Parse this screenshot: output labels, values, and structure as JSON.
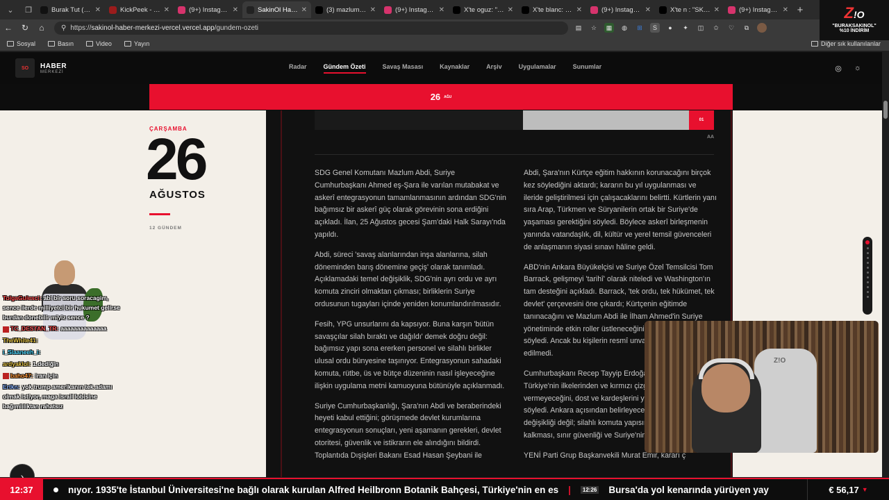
{
  "tabs": [
    {
      "title": "Burak Tut (@bur",
      "icon_color": "#111111"
    },
    {
      "title": "KickPeek - Real-t",
      "icon_color": "#9b1c1c"
    },
    {
      "title": "(9+) Instagram",
      "icon_color": "#d6336c"
    },
    {
      "title": "SakinOl Haber M",
      "icon_color": "#222222",
      "active": true
    },
    {
      "title": "(3) mazlum abdi",
      "icon_color": "#000000"
    },
    {
      "title": "(9+) Instagram",
      "icon_color": "#d6336c"
    },
    {
      "title": "X'te oguz: \"Soy i",
      "icon_color": "#000000"
    },
    {
      "title": "X'te blanc: \"DEFO",
      "icon_color": "#000000"
    },
    {
      "title": "(9+) Instagram",
      "icon_color": "#d6336c"
    },
    {
      "title": "X'te n : \"SKWK",
      "icon_color": "#000000"
    },
    {
      "title": "(9+) Instagram",
      "icon_color": "#d6336c"
    }
  ],
  "url": {
    "scheme": "https://",
    "host": "sakinol-haber-merkezi-vercel.vercel.app",
    "path": "/gundem-ozeti"
  },
  "bookmarks": [
    "Sosyal",
    "Basın",
    "Video",
    "Yayın"
  ],
  "bookmarks_right": "Diğer sık kullanılanlar",
  "stream_logo": {
    "line1": "\"BURAKSAKINOL\"",
    "line2": "%10 İNDİRİM"
  },
  "site": {
    "brand_line1": "HABER",
    "brand_line2": "MERKEZİ",
    "nav": [
      "Radar",
      "Gündem Özeti",
      "Savaş Masası",
      "Kaynaklar",
      "Arşiv",
      "Uygulamalar",
      "Sunumlar"
    ],
    "nav_active": "Gündem Özeti"
  },
  "band": {
    "day": "26",
    "month": "AĞU"
  },
  "date_panel": {
    "weekday": "ÇARŞAMBA",
    "day": "26",
    "month": "AĞUSTOS",
    "count": "12 GÜNDEM"
  },
  "article": {
    "image_badge": "01",
    "aa_label": "AA",
    "col1": [
      "SDG Genel Komutanı Mazlum Abdi, Suriye Cumhurbaşkanı Ahmed eş-Şara ile varılan mutabakat ve askerî entegrasyonun tamamlanmasının ardından SDG'nin bağımsız bir askerî güç olarak görevinin sona erdiğini açıkladı. İlan, 25 Ağustos gecesi Şam'daki Halk Sarayı'nda yapıldı.",
      "Abdi, süreci 'savaş alanlarından inşa alanlarına, silah döneminden barış dönemine geçiş' olarak tanımladı. Açıklamadaki temel değişiklik, SDG'nin ayrı ordu ve ayrı komuta zinciri olmaktan çıkması; birliklerin Suriye ordusunun tugayları içinde yeniden konumlandırılmasıdır.",
      "Fesih, YPG unsurlarını da kapsıyor. Buna karşın 'bütün savaşçılar silah bıraktı ve dağıldı' demek doğru değil: bağımsız yapı sona ererken personel ve silahlı birlikler ulusal ordu bünyesine taşınıyor. Entegrasyonun sahadaki komuta, rütbe, üs ve bütçe düzeninin nasıl işleyeceğine ilişkin uygulama metni kamuoyuna bütünüyle açıklanmadı.",
      "Suriye Cumhurbaşkanlığı, Şara'nın Abdi ve beraberindeki heyeti kabul ettiğini; görüşmede devlet kurumlarına entegrasyonun sonuçları, yeni aşamanın gerekleri, devlet otoritesi, güvenlik ve istikrarın ele alındığını bildirdi. Toplantıda Dışişleri Bakanı Esad Hasan Şeybani ile"
    ],
    "col2": [
      "Abdi, Şara'nın Kürtçe eğitim hakkının korunacağını birçok kez söylediğini aktardı; kararın bu yıl uygulanması ve ileride geliştirilmesi için çalışacaklarını belirtti. Kürtlerin yanı sıra Arap, Türkmen ve Süryanilerin ortak bir Suriye'de yaşaması gerektiğini söyledi. Böylece askerî birleşmenin yanında vatandaşlık, dil, kültür ve yerel temsil güvenceleri de anlaşmanın siyasi sınavı hâline geldi.",
      "ABD'nin Ankara Büyükelçisi ve Suriye Özel Temsilcisi Tom Barrack, gelişmeyi 'tarihî' olarak niteledi ve Washington'ın tam desteğini açıkladı. Barrack, 'tek ordu, tek hükümet, tek devlet' çerçevesini öne çıkardı; Kürtçenin eğitimde tanınacağını ve Mazlum Abdi ile İlham Ahmed'in Suriye yönetiminde etkin roller üstleneceğini öngörüldüğünü söyledi. Ancak bu kişilerin resmî unvanları resmen ilan edilmedi.",
      "Cumhurbaşkanı Recep Tayyip Erdoğan ardından Türkiye'nin ilkelerinden ve kırmızı çizgilerinden taviz vermeyeceğini, dost ve kardeşlerini yalnız bırakmayacağını söyledi. Ankara açısından belirleyecek ölçüt yalnızca isim değişikliği değil; silahlı komuta yapısının fiilen ortadan kalkması, sınır güvenliği ve Suriye'nin toprak bütünlüğü.",
      "YENİ Parti Grup Başkanvekili Murat Emir, kararı ç"
    ]
  },
  "chat": [
    {
      "user": "TolgaGulesci:",
      "text": "abi bir soru soracagim, sence ilerde milliyetci bir hukumet gelirse burdan donebilir miyiz sence ?",
      "color_class": "u1"
    },
    {
      "user": "TC_DESTAN_TR:",
      "text": "aaaaaaaaaaaaaa",
      "color_class": "u2",
      "badge": true
    },
    {
      "user": "TheWhite41:",
      "text": "",
      "color_class": "u5"
    },
    {
      "user": "i_Slaaneeh_i:",
      "text": "",
      "color_class": "u4"
    },
    {
      "user": "ardyaklol:",
      "text": "1.dediğin",
      "color_class": "u5"
    },
    {
      "user": "baho47:",
      "text": "iran için",
      "color_class": "u6",
      "badge": true
    },
    {
      "user": "Ertkn:",
      "text": "yok trump amerikanın tek adamı olmak istiyor, maga israil lobisine bağımlılıktan rahatsız",
      "color_class": "u7"
    }
  ],
  "webcam_logo": "Z!O",
  "ticker": {
    "time": "12:37",
    "text1": "nıyor. 1935'te İstanbul Üniversitesi'ne bağlı olarak kurulan Alfred Heilbronn Botanik Bahçesi, Türkiye'nin en es",
    "small_time": "12:26",
    "text2": "Bursa'da yol kenarında yürüyen yay",
    "fx": "€ 56,17"
  },
  "colors": {
    "accent": "#e8102e",
    "panel": "#f3efe8",
    "dark": "#0d0d0d"
  }
}
